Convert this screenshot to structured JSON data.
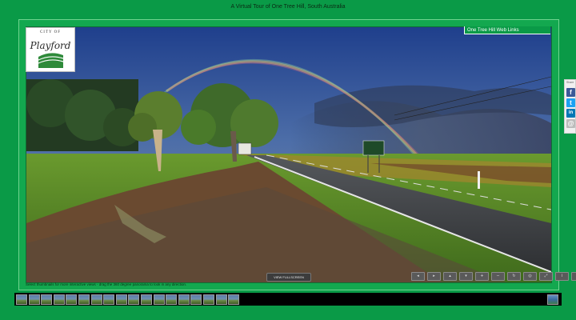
{
  "page": {
    "title": "A Virtual Tour of One Tree Hill, South Australia",
    "instructions": "Select thumbnails for more interactive views - drag the 360 degree panorama to look in any direction."
  },
  "logo": {
    "top_text": "CITY OF",
    "script_text": "Playford"
  },
  "weblinks": {
    "label": "One Tree Hill Web Links"
  },
  "viewer": {
    "fullscreen_label": "VIEW FULLSCREEN",
    "controls": [
      {
        "name": "left-arrow-icon",
        "glyph": "◂"
      },
      {
        "name": "right-arrow-icon",
        "glyph": "▸"
      },
      {
        "name": "up-arrow-icon",
        "glyph": "▴"
      },
      {
        "name": "down-arrow-icon",
        "glyph": "▾"
      },
      {
        "name": "zoom-in-icon",
        "glyph": "+"
      },
      {
        "name": "zoom-out-icon",
        "glyph": "−"
      },
      {
        "name": "autorotate-icon",
        "glyph": "↻"
      },
      {
        "name": "hotspots-icon",
        "glyph": "◎"
      },
      {
        "name": "fullscreen-icon",
        "glyph": "⤢"
      },
      {
        "name": "info-icon",
        "glyph": "i"
      },
      {
        "name": "close-icon",
        "glyph": "×"
      }
    ]
  },
  "thumbnails": {
    "count": 18
  },
  "share": {
    "label": "Share",
    "buttons": [
      {
        "name": "facebook-icon",
        "glyph": "f",
        "color": "#3b5998"
      },
      {
        "name": "twitter-icon",
        "glyph": "t",
        "color": "#1da1f2"
      },
      {
        "name": "linkedin-icon",
        "glyph": "in",
        "color": "#0077b5"
      },
      {
        "name": "email-icon",
        "glyph": "@",
        "color": "#bbbbbb"
      }
    ]
  },
  "colors": {
    "background": "#0a9a47",
    "frame": "#13a84f"
  }
}
